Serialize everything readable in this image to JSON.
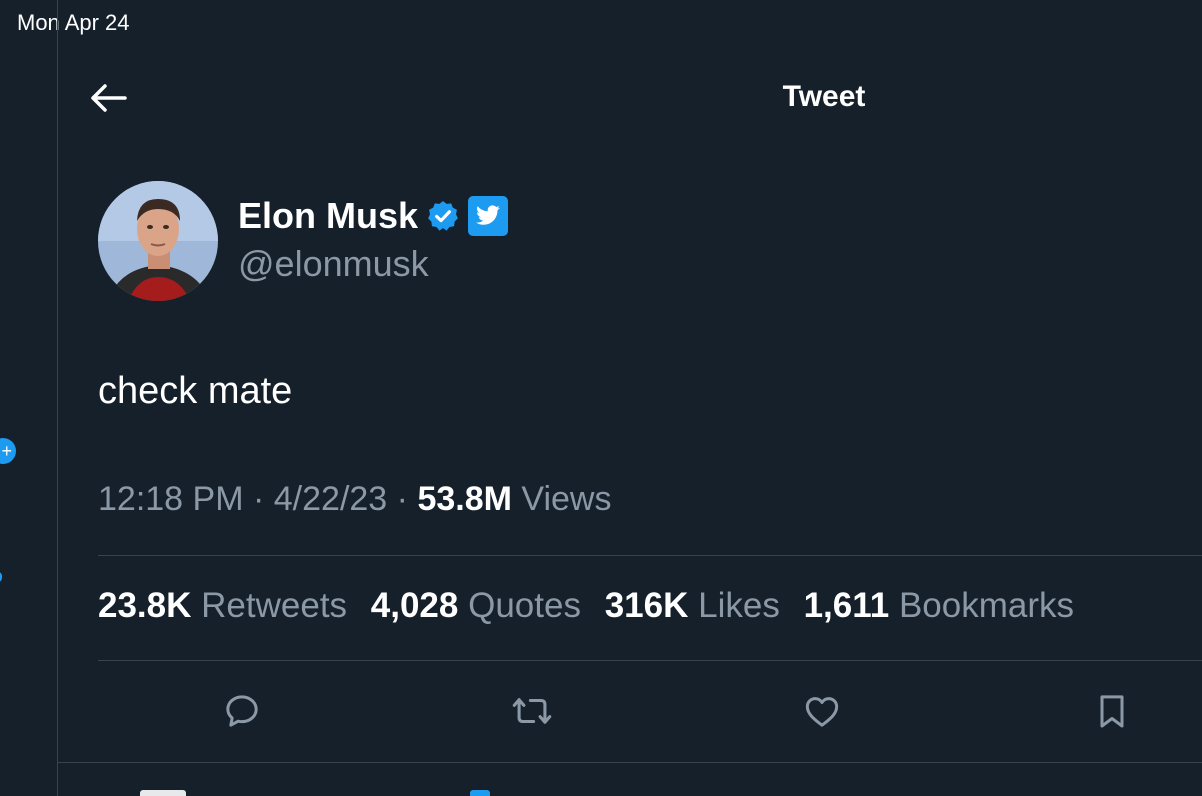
{
  "status_bar": {
    "time": "Mon Apr 24"
  },
  "header": {
    "title": "Tweet"
  },
  "tweet": {
    "author_name": "Elon Musk",
    "author_handle": "@elonmusk",
    "text": "check mate",
    "time": "12:18 PM",
    "date": "4/22/23",
    "separator": "·",
    "views_count": "53.8M",
    "views_label": "Views"
  },
  "stats": {
    "retweets_count": "23.8K",
    "retweets_label": "Retweets",
    "quotes_count": "4,028",
    "quotes_label": "Quotes",
    "likes_count": "316K",
    "likes_label": "Likes",
    "bookmarks_count": "1,611",
    "bookmarks_label": "Bookmarks"
  },
  "actions": [
    "reply-icon",
    "retweet-icon",
    "like-icon",
    "bookmark-icon"
  ],
  "colors": {
    "background": "#15202b",
    "accent": "#1d9bf0",
    "secondary_text": "#8b98a5",
    "divider": "#38444d"
  }
}
